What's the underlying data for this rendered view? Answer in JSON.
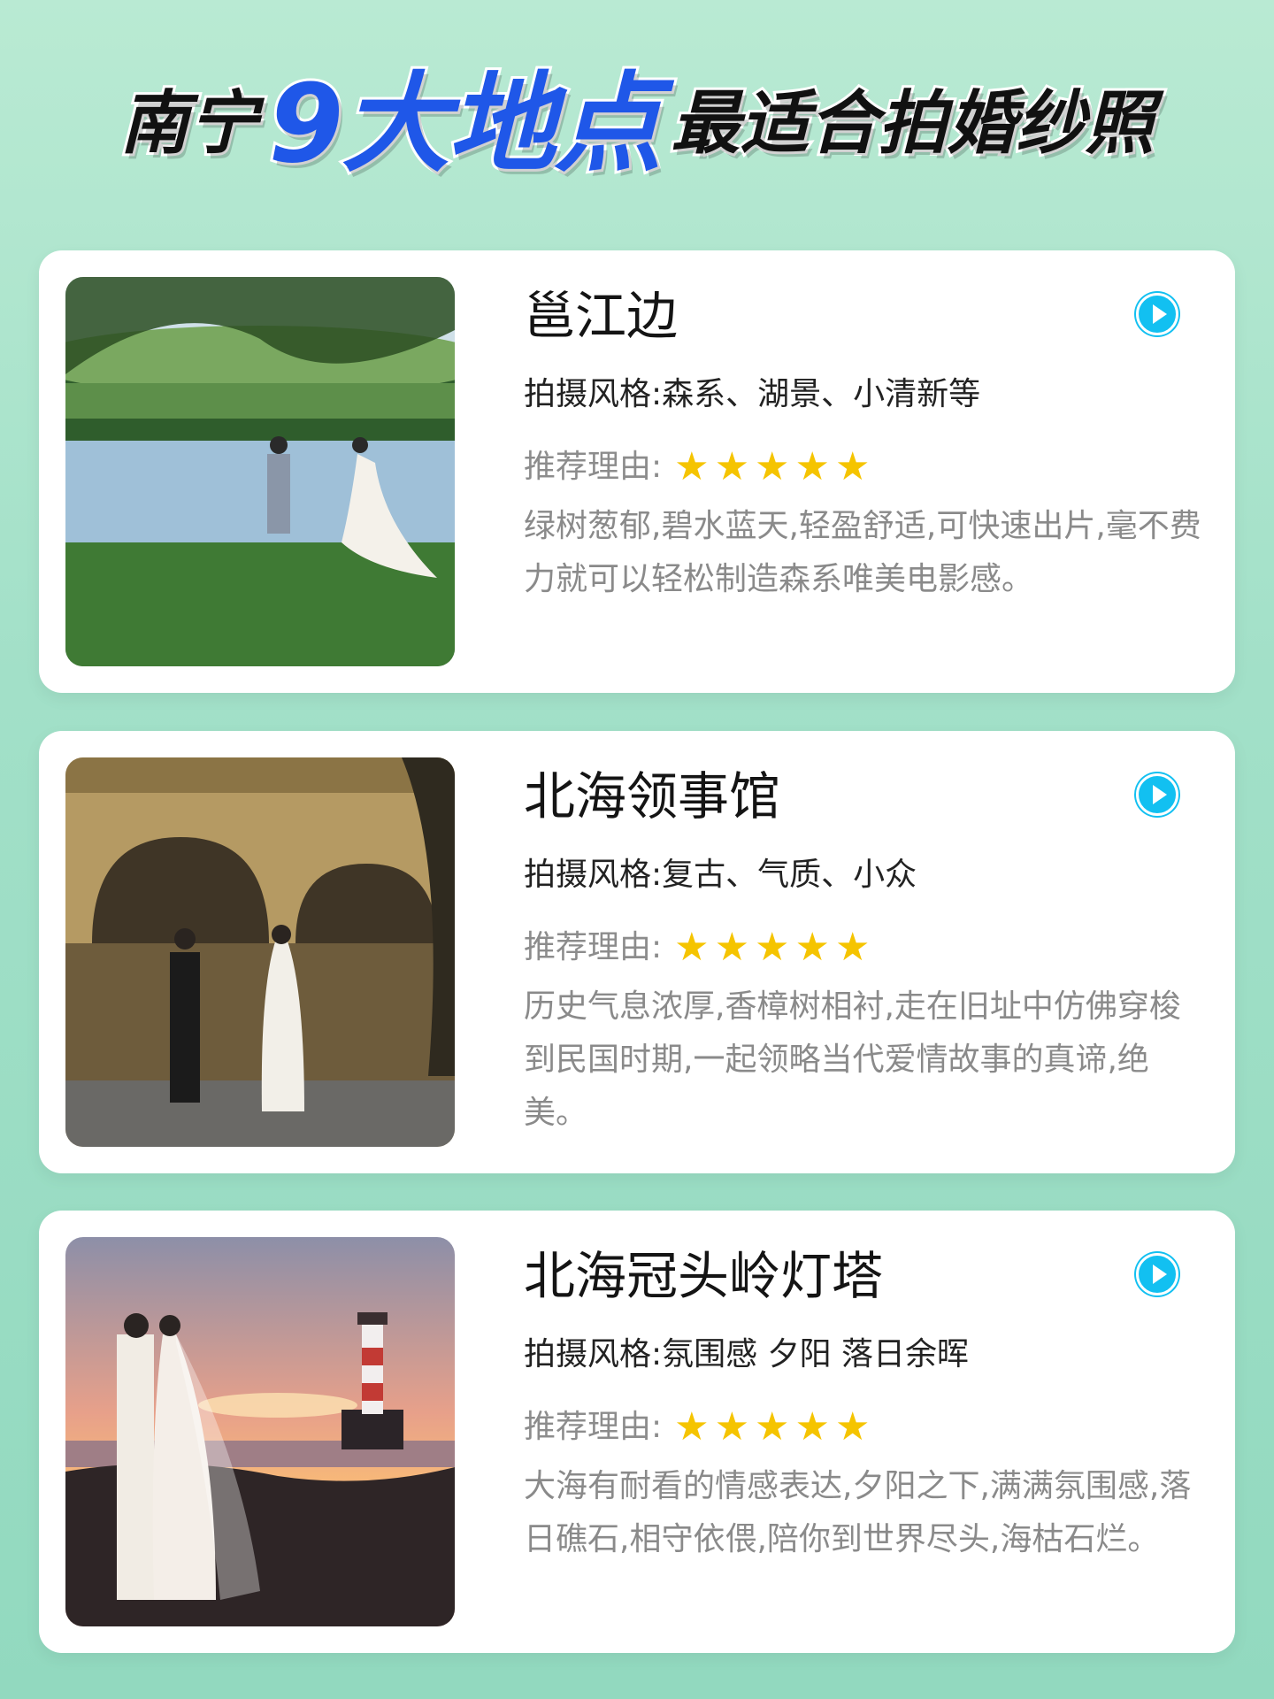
{
  "header": {
    "part_left": "南宁",
    "part_highlight": "9大地点",
    "part_right": "最适合拍婚纱照"
  },
  "cards": [
    {
      "title": "邕江边",
      "style_label": "拍摄风格:",
      "style_value": "森系、湖景、小清新等",
      "reason_label": "推荐理由:",
      "rating": 5,
      "description": "绿树葱郁,碧水蓝天,轻盈舒适,可快速出片,毫不费力就可以轻松制造森系唯美电影感。",
      "photo_icon": "riverside-couple-photo"
    },
    {
      "title": "北海领事馆",
      "style_label": "拍摄风格:",
      "style_value": "复古、气质、小众",
      "reason_label": "推荐理由:",
      "rating": 5,
      "description": "历史气息浓厚,香樟树相衬,走在旧址中仿佛穿梭到民国时期,一起领略当代爱情故事的真谛,绝美。",
      "photo_icon": "consulate-couple-photo"
    },
    {
      "title": "北海冠头岭灯塔",
      "style_label": "拍摄风格:",
      "style_value": "氛围感 夕阳 落日余晖",
      "reason_label": "推荐理由:",
      "rating": 5,
      "description": "大海有耐看的情感表达,夕阳之下,满满氛围感,落日礁石,相守依偎,陪你到世界尽头,海枯石烂。",
      "photo_icon": "lighthouse-sunset-photo"
    }
  ],
  "colors": {
    "highlight_blue": "#1f57e8",
    "play_button": "#12c0f1",
    "star": "#f5c400"
  }
}
